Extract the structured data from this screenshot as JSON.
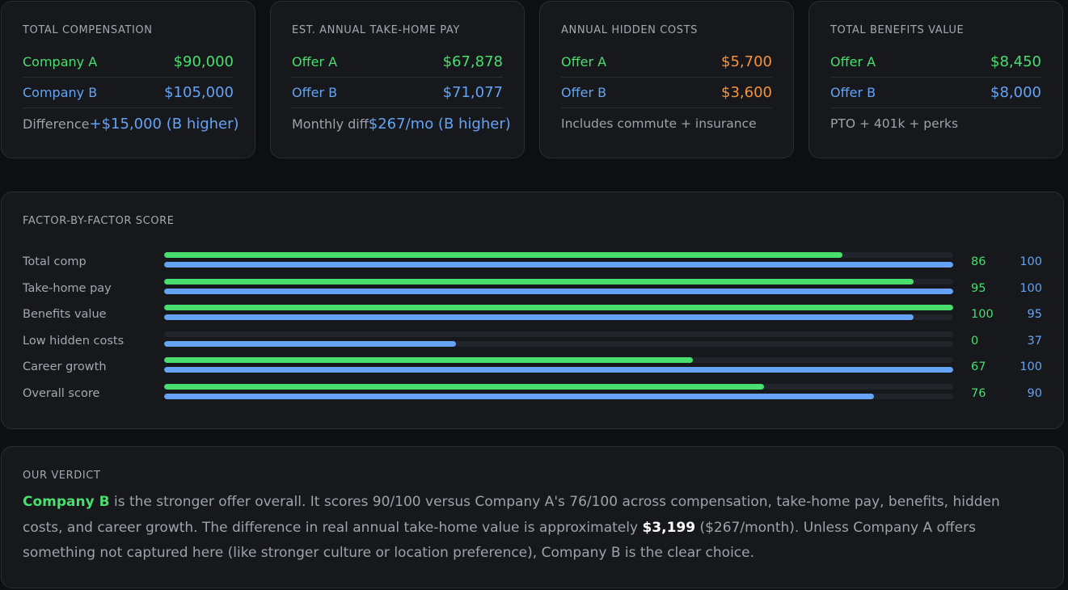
{
  "cards": {
    "total_comp": {
      "title": "TOTAL COMPENSATION",
      "row1_label": "Company A",
      "row1_value": "$90,000",
      "row2_label": "Company B",
      "row2_value": "$105,000",
      "row3_label": "Difference",
      "row3_value": "+$15,000 (B higher)"
    },
    "take_home": {
      "title": "EST. ANNUAL TAKE-HOME PAY",
      "row1_label": "Offer A",
      "row1_value": "$67,878",
      "row2_label": "Offer B",
      "row2_value": "$71,077",
      "row3_label": "Monthly diff",
      "row3_value": "$267/mo (B higher)"
    },
    "hidden_costs": {
      "title": "ANNUAL HIDDEN COSTS",
      "row1_label": "Offer A",
      "row1_value": "$5,700",
      "row2_label": "Offer B",
      "row2_value": "$3,600",
      "note": "Includes commute + insurance"
    },
    "benefits": {
      "title": "TOTAL BENEFITS VALUE",
      "row1_label": "Offer A",
      "row1_value": "$8,450",
      "row2_label": "Offer B",
      "row2_value": "$8,000",
      "note": "PTO + 401k + perks"
    }
  },
  "factors": {
    "title": "FACTOR-BY-FACTOR SCORE",
    "max": 100,
    "rows": [
      {
        "label": "Total comp",
        "a": 86,
        "b": 100
      },
      {
        "label": "Take-home pay",
        "a": 95,
        "b": 100
      },
      {
        "label": "Benefits value",
        "a": 100,
        "b": 95
      },
      {
        "label": "Low hidden costs",
        "a": 0,
        "b": 37
      },
      {
        "label": "Career growth",
        "a": 67,
        "b": 100
      },
      {
        "label": "Overall score",
        "a": 76,
        "b": 90
      }
    ]
  },
  "verdict": {
    "title": "OUR VERDICT",
    "winner": "Company B",
    "text1": " is the stronger offer overall. It scores 90/100 versus Company A's 76/100 across compensation, take-home pay, benefits, hidden costs, and career growth. The difference in real annual take-home value is approximately ",
    "amount": "$3,199",
    "text2": " ($267/month). Unless Company A offers something not captured here (like stronger culture or location preference), Company B is the clear choice."
  },
  "colors": {
    "offer_a": "#4ade6e",
    "offer_b": "#64a3f5",
    "cost": "#f5933e"
  }
}
